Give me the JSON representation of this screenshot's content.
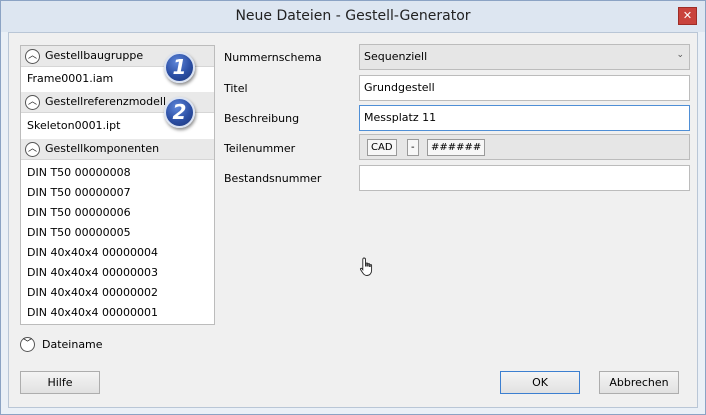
{
  "window": {
    "title": "Neue Dateien - Gestell-Generator",
    "close_label": "✕"
  },
  "left_panel": {
    "sections": [
      {
        "label": "Gestellbaugruppe",
        "items": [
          "Frame0001.iam"
        ],
        "badge": "1"
      },
      {
        "label": "Gestellreferenzmodell",
        "items": [
          "Skeleton0001.ipt"
        ],
        "badge": "2"
      },
      {
        "label": "Gestellkomponenten",
        "items": [
          "DIN T50 00000008",
          "DIN T50 00000007",
          "DIN T50 00000006",
          "DIN T50 00000005",
          "DIN 40x40x4 00000004",
          "DIN 40x40x4 00000003",
          "DIN 40x40x4 00000002",
          "DIN 40x40x4 00000001"
        ]
      }
    ],
    "collapsed_section": "Dateiname"
  },
  "form": {
    "nummernschema": {
      "label": "Nummernschema",
      "value": "Sequenziell"
    },
    "titel": {
      "label": "Titel",
      "value": "Grundgestell"
    },
    "beschreibung": {
      "label": "Beschreibung",
      "value": "Messplatz 11"
    },
    "teilenummer": {
      "label": "Teilenummer",
      "segments": [
        "CAD",
        "-",
        "######"
      ]
    },
    "bestandsnummer": {
      "label": "Bestandsnummer",
      "value": ""
    }
  },
  "buttons": {
    "help": "Hilfe",
    "ok": "OK",
    "cancel": "Abbrechen"
  },
  "icons": {
    "expand": "chevron-up-icon",
    "collapse": "chevron-down-icon",
    "cursor": "hand-cursor-icon"
  }
}
